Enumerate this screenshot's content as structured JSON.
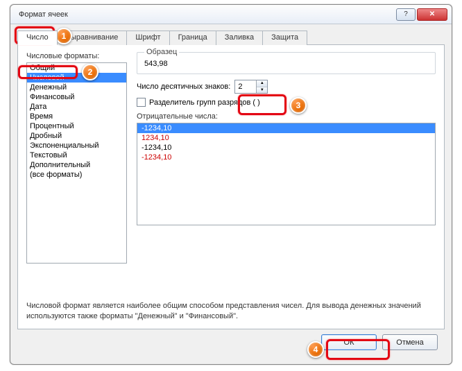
{
  "window": {
    "title": "Формат ячеек"
  },
  "tabs": [
    "Число",
    "Выравнивание",
    "Шрифт",
    "Граница",
    "Заливка",
    "Защита"
  ],
  "left": {
    "label": "Числовые форматы:",
    "items": [
      "Общий",
      "Числовой",
      "Денежный",
      "Финансовый",
      "Дата",
      "Время",
      "Процентный",
      "Дробный",
      "Экспоненциальный",
      "Текстовый",
      "Дополнительный",
      "(все форматы)"
    ],
    "selected": "Числовой"
  },
  "sample": {
    "label": "Образец",
    "value": "543,98"
  },
  "decimals": {
    "label": "Число десятичных знаков:",
    "value": "2"
  },
  "separator": {
    "label": "Разделитель групп разрядов ( )"
  },
  "negative": {
    "label": "Отрицательные числа:",
    "items": [
      {
        "text": "-1234,10",
        "red": false,
        "sel": true
      },
      {
        "text": "1234,10",
        "red": true,
        "sel": false
      },
      {
        "text": "-1234,10",
        "red": false,
        "sel": false
      },
      {
        "text": "-1234,10",
        "red": true,
        "sel": false
      }
    ]
  },
  "description": "Числовой формат является наиболее общим способом представления чисел. Для вывода денежных значений используются также форматы \"Денежный\" и \"Финансовый\".",
  "buttons": {
    "ok": "ОК",
    "cancel": "Отмена"
  },
  "callouts": {
    "1": "1",
    "2": "2",
    "3": "3",
    "4": "4"
  }
}
